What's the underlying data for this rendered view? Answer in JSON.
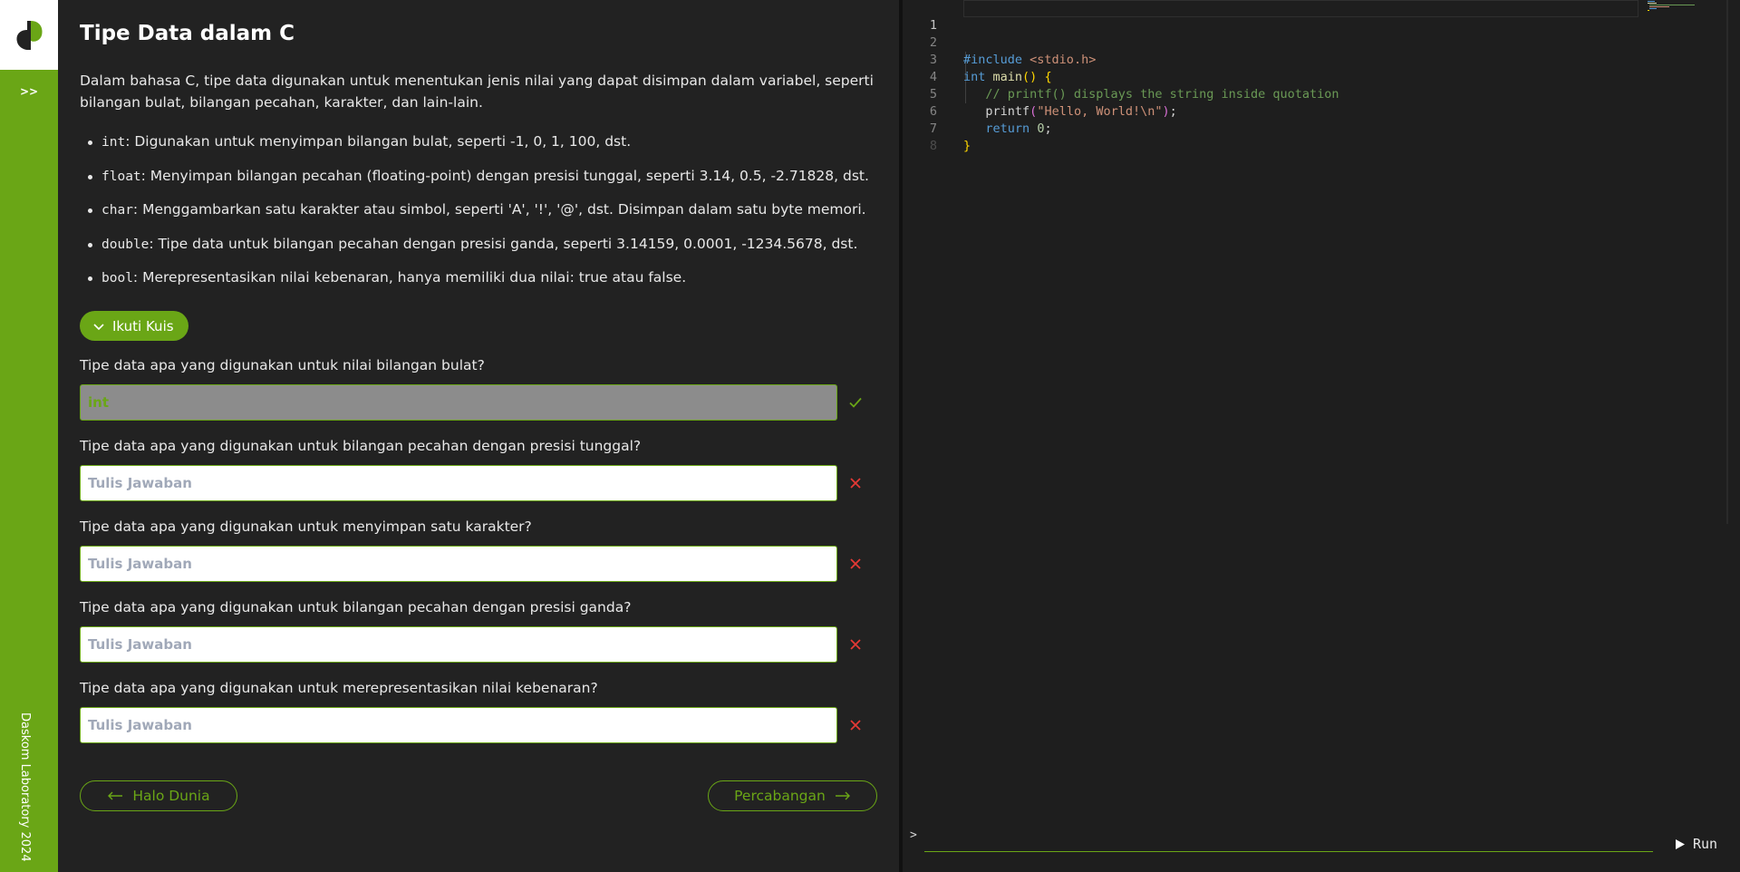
{
  "sidebar": {
    "expand_label": ">>",
    "footer": "Daskom Laboratory 2024"
  },
  "lesson": {
    "title": "Tipe Data dalam C",
    "intro": "Dalam bahasa C, tipe data digunakan untuk menentukan jenis nilai yang dapat disimpan dalam variabel, seperti bilangan bulat, bilangan pecahan, karakter, dan lain-lain.",
    "types": [
      {
        "code": "int",
        "desc": ": Digunakan untuk menyimpan bilangan bulat, seperti -1, 0, 1, 100, dst."
      },
      {
        "code": "float",
        "desc": ": Menyimpan bilangan pecahan (floating-point) dengan presisi tunggal, seperti 3.14, 0.5, -2.71828, dst."
      },
      {
        "code": "char",
        "desc": ": Menggambarkan satu karakter atau simbol, seperti 'A', '!', '@', dst. Disimpan dalam satu byte memori."
      },
      {
        "code": "double",
        "desc": ": Tipe data untuk bilangan pecahan dengan presisi ganda, seperti 3.14159, 0.0001, -1234.5678, dst."
      },
      {
        "code": "bool",
        "desc": ": Merepresentasikan nilai kebenaran, hanya memiliki dua nilai: true atau false."
      }
    ]
  },
  "quiz": {
    "toggle_label": "Ikuti Kuis",
    "questions": [
      {
        "question": "Tipe data apa yang digunakan untuk nilai bilangan bulat?",
        "value": "int",
        "placeholder": "Tulis Jawaban",
        "status": "correct"
      },
      {
        "question": "Tipe data apa yang digunakan untuk bilangan pecahan dengan presisi tunggal?",
        "value": "",
        "placeholder": "Tulis Jawaban",
        "status": "incorrect"
      },
      {
        "question": "Tipe data apa yang digunakan untuk menyimpan satu karakter?",
        "value": "",
        "placeholder": "Tulis Jawaban",
        "status": "incorrect"
      },
      {
        "question": "Tipe data apa yang digunakan untuk bilangan pecahan dengan presisi ganda?",
        "value": "",
        "placeholder": "Tulis Jawaban",
        "status": "incorrect"
      },
      {
        "question": "Tipe data apa yang digunakan untuk merepresentasikan nilai kebenaran?",
        "value": "",
        "placeholder": "Tulis Jawaban",
        "status": "incorrect"
      }
    ]
  },
  "navigation": {
    "prev_label": "Halo Dunia",
    "next_label": "Percabangan"
  },
  "editor": {
    "line_numbers": [
      "1",
      "2",
      "3",
      "4",
      "5",
      "6",
      "7",
      "8"
    ],
    "code": {
      "l2_directive": "#include",
      "l2_header": "<stdio.h>",
      "l3_type": "int",
      "l3_fn": "main",
      "l3_parens": "()",
      "l3_brace": "{",
      "l4_comment": "// printf() displays the string inside quotation",
      "l5_fn": "printf",
      "l5_open": "(",
      "l5_string": "\"Hello, World!\\n\"",
      "l5_close": ")",
      "l5_semi": ";",
      "l6_kw": "return",
      "l6_num": "0",
      "l6_semi": ";",
      "l7_brace": "}"
    }
  },
  "terminal": {
    "prompt": ">",
    "input_value": "",
    "run_label": "Run"
  },
  "colors": {
    "accent": "#6aa616",
    "error": "#e53935",
    "background": "#222222",
    "editor_background": "#1e1e1e"
  }
}
